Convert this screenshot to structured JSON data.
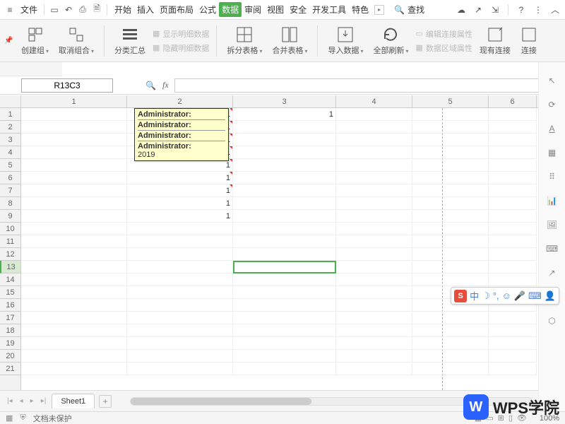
{
  "top": {
    "file": "文件",
    "search": "查找",
    "tabs": [
      "开始",
      "插入",
      "页面布局",
      "公式",
      "数据",
      "审阅",
      "视图",
      "安全",
      "开发工具",
      "特色"
    ],
    "active_tab": 4
  },
  "ribbon": {
    "create_group": "创建组",
    "ungroup": "取消组合",
    "subtotal": "分类汇总",
    "show_detail": "显示明细数据",
    "hide_detail": "隐藏明细数据",
    "split_table": "拆分表格",
    "merge_table": "合并表格",
    "import_data": "导入数据",
    "refresh_all": "全部刷新",
    "edit_conn": "编辑连接属性",
    "data_region": "数据区域属性",
    "existing_conn": "现有连接",
    "connection": "连接"
  },
  "fx": {
    "cellref": "R13C3"
  },
  "cols": [
    "1",
    "2",
    "3",
    "4",
    "5",
    "6"
  ],
  "rows": [
    "1",
    "2",
    "3",
    "4",
    "5",
    "6",
    "7",
    "8",
    "9",
    "10",
    "11",
    "12",
    "13",
    "14",
    "15",
    "16",
    "17",
    "18",
    "19",
    "20",
    "21"
  ],
  "cells": {
    "r1c2": "1",
    "r2c2": "1",
    "r3c2": "1",
    "r4c2": "1",
    "r5c2": "1",
    "r6c2": "1",
    "r7c2": "1",
    "r8c2": "1",
    "r9c2": "1",
    "r1c3": "1"
  },
  "comment": {
    "l1": "Administrator:",
    "l2": "Administrator:",
    "l3": "Administrator:",
    "l4": "Administrator:",
    "l5": "2019"
  },
  "sheet_tab": "Sheet1",
  "status": {
    "protect": "文档未保护",
    "zoom": "100%"
  },
  "float": {
    "cn": "中"
  },
  "logo": "WPS学院"
}
